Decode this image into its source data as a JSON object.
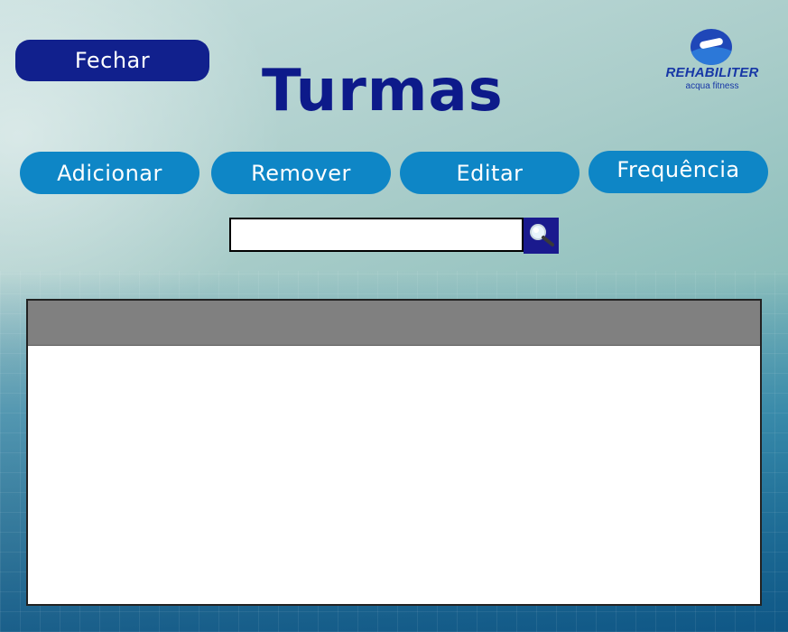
{
  "header": {
    "close_label": "Fechar",
    "title": "Turmas"
  },
  "logo": {
    "name": "REHABILITER",
    "tagline": "acqua fitness",
    "icon": "swimmer-logo-icon"
  },
  "toolbar": {
    "add_label": "Adicionar",
    "remove_label": "Remover",
    "edit_label": "Editar",
    "attendance_label": "Frequência"
  },
  "search": {
    "value": "",
    "placeholder": "",
    "icon": "magnifier-icon"
  },
  "table": {
    "columns": [],
    "rows": []
  },
  "colors": {
    "primary_dark": "#11208d",
    "title": "#0d1a8a",
    "button": "#0e86c6",
    "table_header": "#808080"
  }
}
